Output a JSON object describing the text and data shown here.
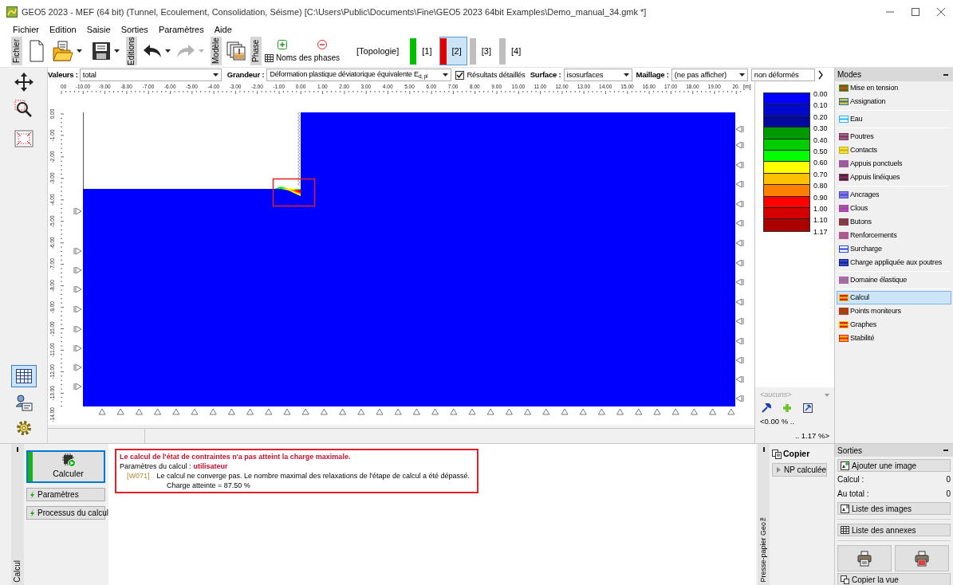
{
  "window": {
    "title": "GEO5 2023 - MEF (64 bit) (Tunnel, Ecoulement, Consolidation, Séisme) [C:\\Users\\Public\\Documents\\Fine\\GEO5 2023 64bit Examples\\Demo_manual_34.gmk *]"
  },
  "menu": [
    "Fichier",
    "Edition",
    "Saisie",
    "Sorties",
    "Paramètres",
    "Aide"
  ],
  "toolbar": {
    "file_label": "Fichier",
    "edit_label": "Editions",
    "model_label": "Modèle",
    "phase_label": "Phase",
    "phase_names": "Noms des phases",
    "undo": {
      "disabled": false
    },
    "redo": {
      "disabled": true
    }
  },
  "phase_tabs": [
    {
      "label": "[Topologie]",
      "kind": "topology",
      "selected": false
    },
    {
      "label": "[1]",
      "kind": "phase",
      "color": "#00c000",
      "selected": false
    },
    {
      "label": "[2]",
      "kind": "phase",
      "color": "#e00000",
      "selected": true
    },
    {
      "label": "[3]",
      "kind": "phase",
      "color": "#bfbfbf",
      "selected": false
    },
    {
      "label": "[4]",
      "kind": "phase",
      "color": "#bfbfbf",
      "selected": false
    }
  ],
  "view_options": {
    "values_label": "Valeurs :",
    "values": "total",
    "quantity_label": "Grandeur :",
    "quantity": "Déformation plastique déviatorique équivalente E$_{d, pl}$",
    "detailed": {
      "label": "Résultats détaillés",
      "checked": true
    },
    "surface_label": "Surface :",
    "surface": "isosurfaces",
    "mesh_label": "Maillage :",
    "mesh": "(ne pas afficher)",
    "deformation": "non déformés"
  },
  "ruler": {
    "x_labels": [
      "00",
      "-10.00",
      "-9.00",
      "-8.00",
      "-7.00",
      "-6.00",
      "-5.00",
      "-4.00",
      "-3.00",
      "-2.00",
      "-1.00",
      "0.00",
      "1.00",
      "2.00",
      "3.00",
      "4.00",
      "5.00",
      "6.00",
      "7.00",
      "8.00",
      "9.00",
      "10.00",
      "11.00",
      "12.00",
      "13.00",
      "14.00",
      "15.00",
      "16.00",
      "17.00",
      "18.00",
      "19.00",
      "20."
    ],
    "unit": "[m]",
    "y_labels": [
      "0.00",
      "-1.00",
      "-2.00",
      "-3.00",
      "-4.00",
      "-5.00",
      "-6.00",
      "-7.00",
      "-8.00",
      "-9.00",
      "-10.00",
      "-11.00",
      "-12.00",
      "-13.00",
      "-14.00"
    ]
  },
  "legend": {
    "bands": [
      {
        "color": "#0000ff"
      },
      {
        "color": "#0008cc"
      },
      {
        "color": "#00099e"
      },
      {
        "color": "#009a00"
      },
      {
        "color": "#00cc00"
      },
      {
        "color": "#00ff00"
      },
      {
        "color": "#ffff00"
      },
      {
        "color": "#ffc000"
      },
      {
        "color": "#ff8000"
      },
      {
        "color": "#ff0000"
      },
      {
        "color": "#d40000"
      },
      {
        "color": "#aa0000"
      }
    ],
    "values": [
      "0.00",
      "0.10",
      "0.20",
      "0.30",
      "0.40",
      "0.50",
      "0.60",
      "0.70",
      "0.80",
      "0.90",
      "1.00",
      "1.10",
      "1.17"
    ]
  },
  "scale_filter": {
    "placeholder": "<aucuns>",
    "min": "<0.00 % ..",
    "max": ".. 1.17 %>"
  },
  "modes": {
    "title": "Modes",
    "groups": [
      {
        "items": [
          {
            "label": "Mise en tension",
            "selected": false
          },
          {
            "label": "Assignation",
            "selected": false
          }
        ]
      },
      {
        "items": [
          {
            "label": "Eau",
            "selected": false
          }
        ]
      },
      {
        "items": [
          {
            "label": "Poutres",
            "selected": false
          },
          {
            "label": "Contacts",
            "selected": false
          },
          {
            "label": "Appuis ponctuels",
            "selected": false
          },
          {
            "label": "Appuis linéiques",
            "selected": false
          }
        ]
      },
      {
        "items": [
          {
            "label": "Ancrages",
            "selected": false
          },
          {
            "label": "Clous",
            "selected": false
          },
          {
            "label": "Butons",
            "selected": false
          },
          {
            "label": "Renforcements",
            "selected": false
          },
          {
            "label": "Surcharge",
            "selected": false
          },
          {
            "label": "Charge appliquée aux poutres",
            "selected": false
          }
        ]
      },
      {
        "items": [
          {
            "label": "Domaine élastique",
            "selected": false
          }
        ]
      },
      {
        "items": [
          {
            "label": "Calcul",
            "selected": true
          },
          {
            "label": "Points moniteurs",
            "selected": false
          },
          {
            "label": "Graphes",
            "selected": false
          },
          {
            "label": "Stabilité",
            "selected": false
          }
        ]
      }
    ]
  },
  "calc_panel": {
    "tab": "Calcul",
    "calculate": "Calculer",
    "buttons": [
      "Paramètres",
      "Processus du calcul"
    ]
  },
  "messages": {
    "title": "Le calcul de l'état de contraintes n'a pas atteint la charge maximale.",
    "params_label": "Paramètres du calcul :",
    "params_value": "utilisateur",
    "code": "[W071]",
    "warning": "Le calcul ne converge pas. Le nombre maximal des relaxations de l'étape de calcul a été dépassé.",
    "load": "Charge atteinte = 87.50 %"
  },
  "clipboard": {
    "tab": "Presse-papier Geo™",
    "copy": "Copier",
    "items": [
      "NP calculée"
    ]
  },
  "outputs": {
    "title": "Sorties",
    "add_image": "Ajouter une image",
    "counts": [
      {
        "label": "Calcul :",
        "value": "0"
      },
      {
        "label": "Au total :",
        "value": "0"
      }
    ],
    "list_images": "Liste des images",
    "list_annexes": "Liste des annexes",
    "copy_view": "Copier la vue"
  }
}
